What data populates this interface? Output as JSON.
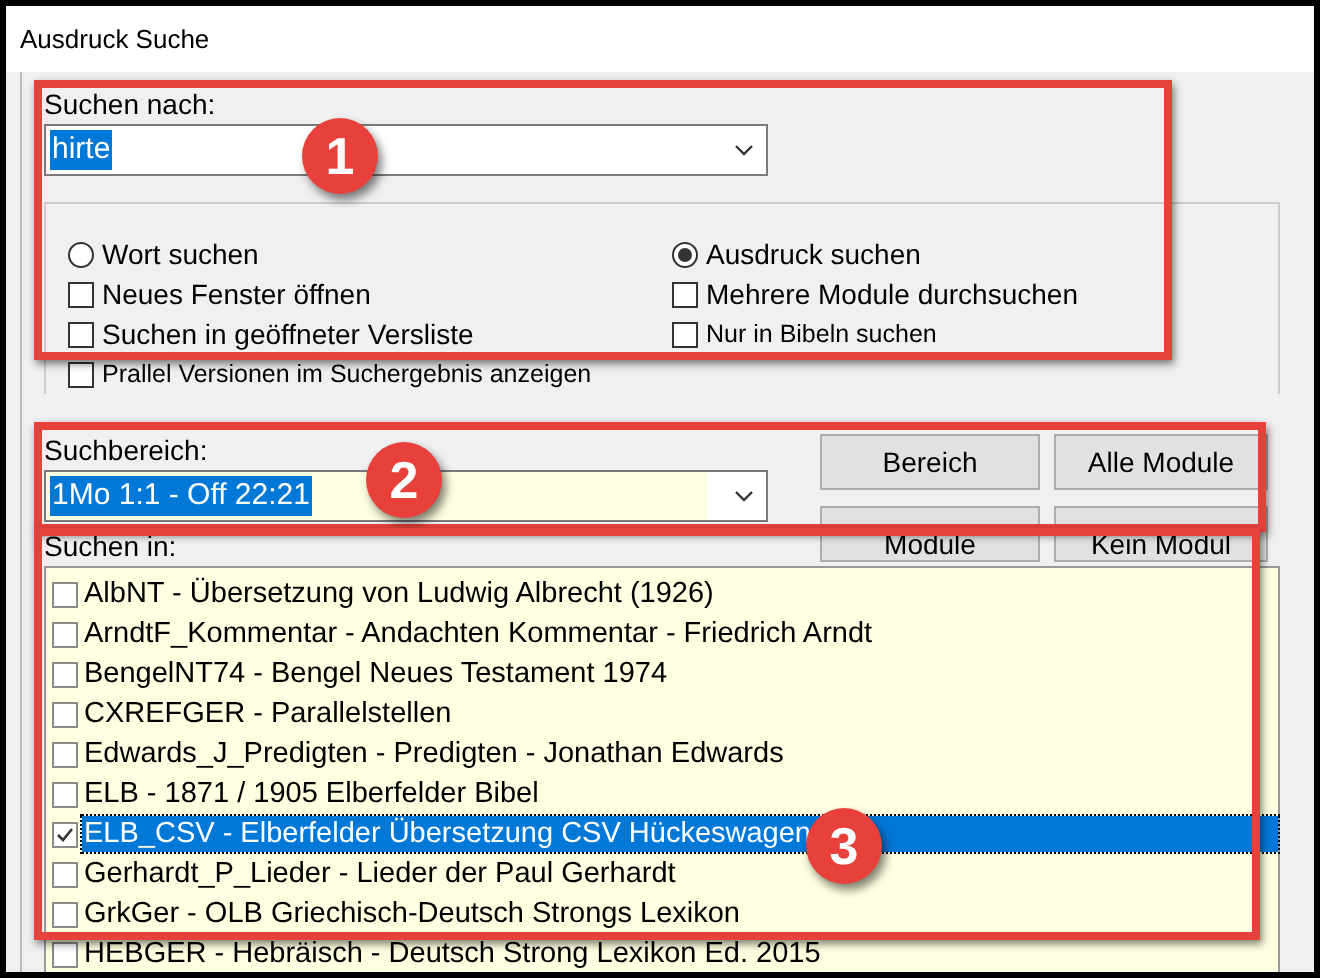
{
  "window": {
    "title": "Ausdruck Suche"
  },
  "search": {
    "label": "Suchen nach:",
    "value": "hirte"
  },
  "options": [
    {
      "kind": "radio",
      "label": "Wort suchen",
      "selected": false,
      "small": false
    },
    {
      "kind": "radio",
      "label": "Ausdruck suchen",
      "selected": true,
      "small": false
    },
    {
      "kind": "checkbox",
      "label": "Neues Fenster öffnen",
      "checked": false,
      "small": false
    },
    {
      "kind": "checkbox",
      "label": "Mehrere Module durchsuchen",
      "checked": false,
      "small": false
    },
    {
      "kind": "checkbox",
      "label": "Suchen in geöffneter Versliste",
      "checked": false,
      "small": false
    },
    {
      "kind": "checkbox",
      "label": "Nur in Bibeln suchen",
      "checked": false,
      "small": true
    },
    {
      "kind": "checkbox",
      "label": "Prallel Versionen im Suchergebnis anzeigen",
      "checked": false,
      "small": true
    }
  ],
  "range": {
    "label": "Suchbereich:",
    "value": "1Mo 1:1 - Off 22:21"
  },
  "buttons": [
    {
      "label": "Bereich"
    },
    {
      "label": "Alle Module"
    },
    {
      "label": "Module"
    },
    {
      "label": "Kein Modul"
    }
  ],
  "modules": {
    "label": "Suchen in:",
    "items": [
      {
        "label": "AlbNT - Übersetzung von Ludwig Albrecht (1926)",
        "checked": false,
        "selected": false
      },
      {
        "label": "ArndtF_Kommentar - Andachten Kommentar - Friedrich Arndt",
        "checked": false,
        "selected": false
      },
      {
        "label": "BengelNT74 - Bengel Neues Testament 1974",
        "checked": false,
        "selected": false
      },
      {
        "label": "CXREFGER - Parallelstellen",
        "checked": false,
        "selected": false
      },
      {
        "label": "Edwards_J_Predigten - Predigten - Jonathan Edwards",
        "checked": false,
        "selected": false
      },
      {
        "label": "ELB - 1871 / 1905 Elberfelder Bibel",
        "checked": false,
        "selected": false
      },
      {
        "label": "ELB_CSV - Elberfelder Übersetzung CSV Hückeswagen",
        "checked": true,
        "selected": true
      },
      {
        "label": "Gerhardt_P_Lieder - Lieder der Paul Gerhardt",
        "checked": false,
        "selected": false
      },
      {
        "label": "GrkGer - OLB Griechisch-Deutsch Strongs Lexikon",
        "checked": false,
        "selected": false
      },
      {
        "label": "HEBGER - Hebräisch - Deutsch Strong Lexikon Ed. 2015",
        "checked": false,
        "selected": false
      }
    ]
  },
  "annotations": [
    {
      "number": "1"
    },
    {
      "number": "2"
    },
    {
      "number": "3"
    }
  ]
}
